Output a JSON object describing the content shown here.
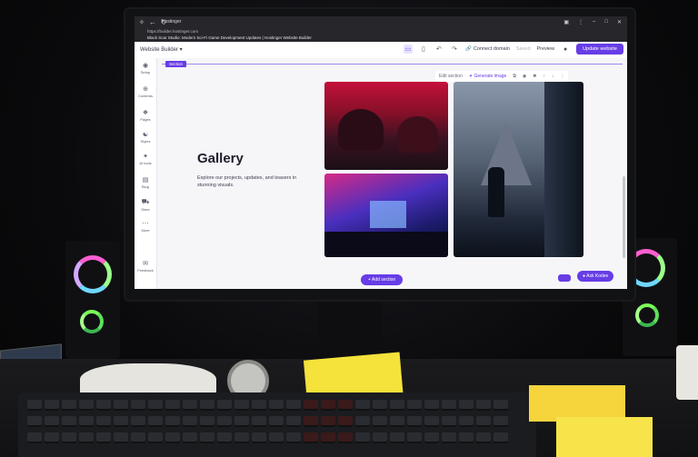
{
  "browser": {
    "tab_title": "Hostinger",
    "url": "https://builder.hostinger.com",
    "page_title": "Black Scar Studio: Modern Sci-Fi Game Development Updates | Hostinger Website Builder"
  },
  "toolbar": {
    "site_label": "Website Builder",
    "connect_domain": "Connect domain",
    "save": "Saved",
    "preview": "Preview",
    "update": "Update website"
  },
  "sidebar": {
    "items": [
      {
        "label": "Setup",
        "icon": "setup-icon"
      },
      {
        "label": "Contents",
        "icon": "plus-icon"
      },
      {
        "label": "Pages",
        "icon": "pages-icon"
      },
      {
        "label": "Styles",
        "icon": "styles-icon"
      },
      {
        "label": "AI tools",
        "icon": "ai-icon"
      },
      {
        "label": "Blog",
        "icon": "blog-icon"
      },
      {
        "label": "Store",
        "icon": "store-icon"
      },
      {
        "label": "More",
        "icon": "more-icon"
      },
      {
        "label": "Feedback",
        "icon": "feedback-icon"
      }
    ]
  },
  "section": {
    "tag": "Section",
    "edit_section": "Edit section",
    "generate_image": "Generate image",
    "add_section": "Add section",
    "ask_kodee": "Ask Kodee"
  },
  "gallery": {
    "title": "Gallery",
    "description": "Explore our projects, updates, and teasers in stunning visuals."
  },
  "colors": {
    "accent": "#673de6"
  }
}
